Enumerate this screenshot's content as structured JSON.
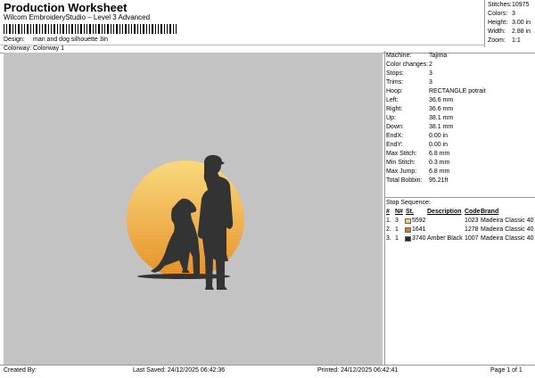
{
  "header": {
    "title": "Production Worksheet",
    "software": "Wilcom EmbroideryStudio – Level 3 Advanced"
  },
  "design_info": {
    "design_label": "Design:",
    "design_value": "man and dog silhouette 3in",
    "colorway_label": "Colorway:",
    "colorway_value": "Colorway 1"
  },
  "stats": [
    {
      "label": "Stitches:",
      "value": "10975"
    },
    {
      "label": "Colors:",
      "value": "3"
    },
    {
      "label": "Height:",
      "value": "3.00 in"
    },
    {
      "label": "Width:",
      "value": "2.88 in"
    },
    {
      "label": "Zoom:",
      "value": "1:1"
    }
  ],
  "machine_info": [
    {
      "label": "Machine:",
      "value": "Tajima"
    },
    {
      "label": "Color changes:",
      "value": "2"
    },
    {
      "label": "Stops:",
      "value": "3"
    },
    {
      "label": "Trims:",
      "value": "3"
    },
    {
      "label": "Hoop:",
      "value": "RECTANGLE potrait"
    },
    {
      "label": "Left:",
      "value": "36.6 mm"
    },
    {
      "label": "Right:",
      "value": "36.6 mm"
    },
    {
      "label": "Up:",
      "value": "38.1 mm"
    },
    {
      "label": "Down:",
      "value": "38.1 mm"
    },
    {
      "label": "EndX:",
      "value": "0.00 in"
    },
    {
      "label": "EndY:",
      "value": "0.00 in"
    },
    {
      "label": "Max Stitch:",
      "value": "6.8 mm"
    },
    {
      "label": "Min Stitch:",
      "value": "0.3 mm"
    },
    {
      "label": "Max Jump:",
      "value": "6.8 mm"
    },
    {
      "label": "Total Bobbin:",
      "value": "95.21ft"
    }
  ],
  "stop_sequence": {
    "title": "Stop Sequence:",
    "headers": [
      "#",
      "N#",
      "St.",
      "Description",
      "Code",
      "Brand"
    ],
    "rows": [
      {
        "num": "1.",
        "needle": "3",
        "color": "#f7cf6d",
        "stitches": "5592",
        "description": "",
        "code": "1023",
        "brand": "Madeira Classic 40"
      },
      {
        "num": "2.",
        "needle": "1",
        "color": "#e0781e",
        "stitches": "1641",
        "description": "",
        "code": "1278",
        "brand": "Madeira Classic 40"
      },
      {
        "num": "3.",
        "needle": "1",
        "color": "#2a2a2a",
        "stitches": "3740",
        "description": "Amber Black",
        "code": "1007",
        "brand": "Madeira Classic 40"
      }
    ]
  },
  "footer": {
    "created_by": "Created By:",
    "last_saved": "Last Saved: 24/12/2025 06:42:36",
    "printed": "Printed: 24/12/2025 06:42:41",
    "page": "Page 1 of 1"
  },
  "colors": {
    "design_background": "#c3c3c3",
    "sun_top": "#f7d77a",
    "sun_bottom": "#e08a22",
    "silhouette": "#333333"
  }
}
